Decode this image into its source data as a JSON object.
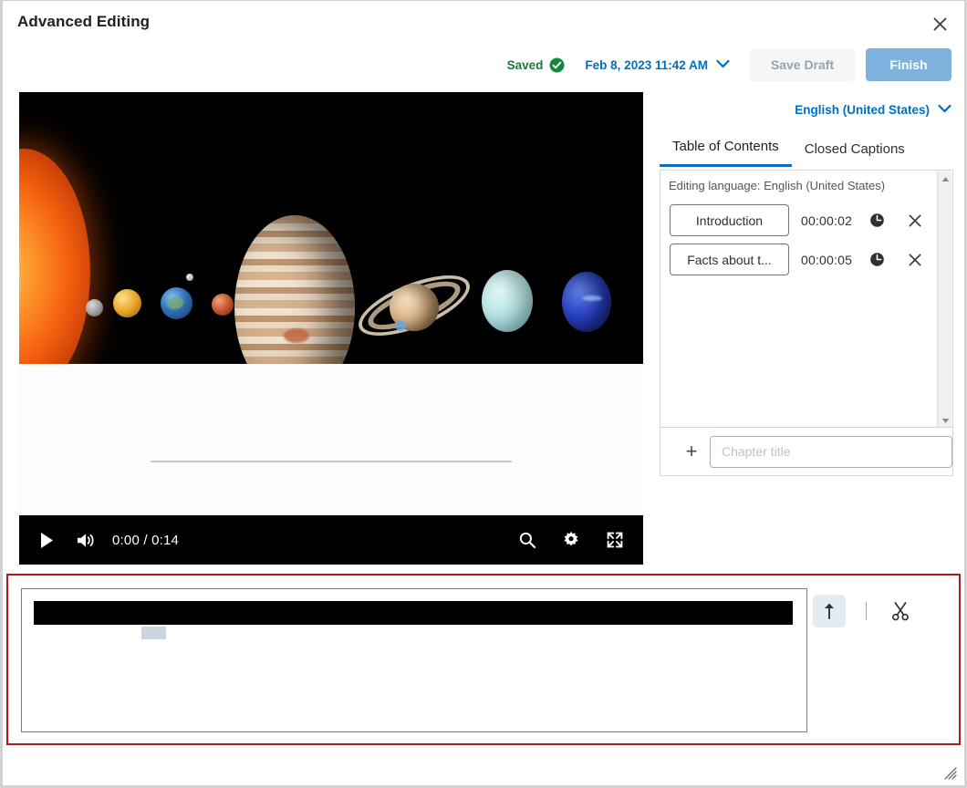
{
  "window": {
    "title": "Advanced Editing",
    "close_icon": "close-icon",
    "resize_grip_icon": "resize-grip-icon"
  },
  "actionbar": {
    "saved_label": "Saved",
    "saved_icon": "check-circle-icon",
    "saved_color": "#1a7a3c",
    "date_label": "Feb 8, 2023 11:42 AM",
    "date_chevron_icon": "chevron-down-icon",
    "date_color": "#006fbf",
    "save_draft_label": "Save Draft",
    "finish_label": "Finish",
    "finish_color": "#7fb2dd"
  },
  "player": {
    "play_icon": "play-icon",
    "volume_icon": "volume-icon",
    "time_display": "0:00 / 0:14",
    "current_time": "0:00",
    "duration": "0:14",
    "search_icon": "search-icon",
    "settings_icon": "gear-icon",
    "fullscreen_icon": "fullscreen-icon",
    "video_description": "Solar system planets lined up beside the sun"
  },
  "right_panel": {
    "language_label": "English (United States)",
    "language_chevron_icon": "chevron-down-icon",
    "tabs": [
      {
        "label": "Table of Contents",
        "active": true
      },
      {
        "label": "Closed Captions",
        "active": false
      }
    ],
    "editing_language_note": "Editing language: English (United States)",
    "chapters": [
      {
        "title": "Introduction",
        "time": "00:00:02",
        "clock_icon": "clock-icon",
        "delete_icon": "close-icon"
      },
      {
        "title": "Facts about t...",
        "time": "00:00:05",
        "clock_icon": "clock-icon",
        "delete_icon": "close-icon"
      }
    ],
    "add_chapter": {
      "plus_icon": "plus-icon",
      "plus_label": "+",
      "input_value": "",
      "input_placeholder": "Chapter title"
    },
    "scrollbar": {
      "up_icon": "scroll-up-arrow-icon",
      "down_icon": "scroll-down-arrow-icon"
    }
  },
  "timeline": {
    "highlight_color": "#a91d1d",
    "upload_icon": "up-arrow-icon",
    "cut_icon": "scissors-icon",
    "divider_icon": "divider-icon",
    "waveform_color": "#000000",
    "marker_color": "#ccd5dd"
  }
}
